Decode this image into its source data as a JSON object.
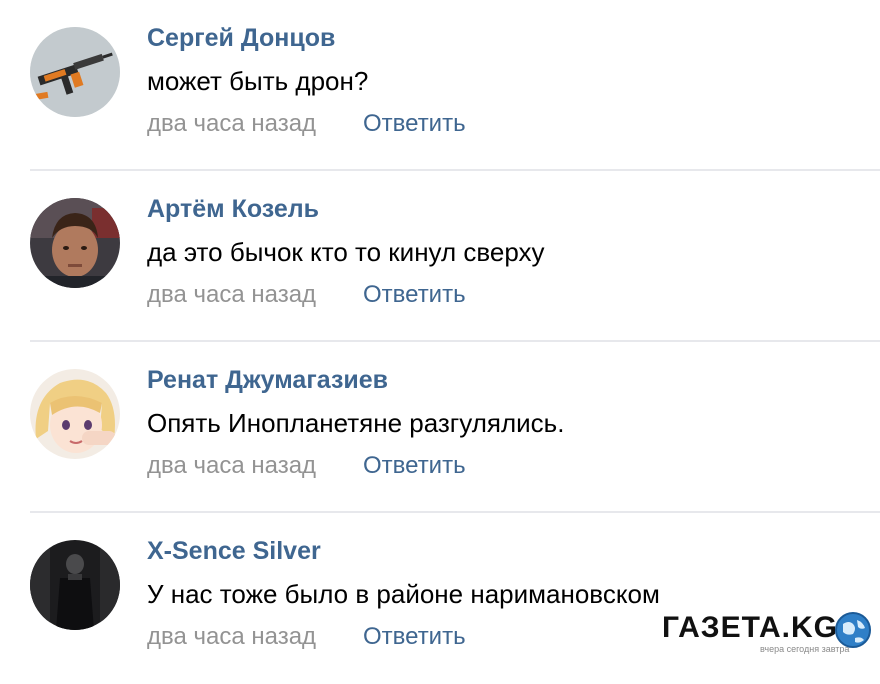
{
  "comments": [
    {
      "author": "Сергей Донцов",
      "text": "может быть дрон?",
      "time": "два часа назад",
      "reply_label": "Ответить",
      "avatar_icon": "rifle-avatar"
    },
    {
      "author": "Артём Козель",
      "text": "да это бычок кто то кинул сверху",
      "time": "два часа назад",
      "reply_label": "Ответить",
      "avatar_icon": "photo-avatar"
    },
    {
      "author": "Ренат Джумагазиев",
      "text": "Опять Инопланетяне разгулялись.",
      "time": "два часа назад",
      "reply_label": "Ответить",
      "avatar_icon": "anime-avatar"
    },
    {
      "author": "X-Sence Silver",
      "text": "У нас тоже было в районе наримановском",
      "time": "два часа назад",
      "reply_label": "Ответить",
      "avatar_icon": "dark-photo-avatar"
    }
  ],
  "watermark": {
    "logo_text": "ГАЗЕТА.KG",
    "tagline": "вчера сегодня завтра"
  },
  "colors": {
    "author": "#3f6690",
    "reply": "#3f6690",
    "time": "#939393",
    "text": "#000000",
    "divider": "#e7e8ec"
  }
}
